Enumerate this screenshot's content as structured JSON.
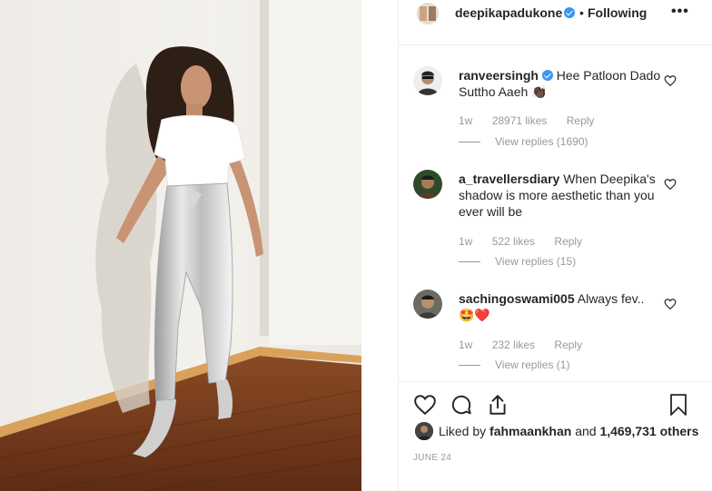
{
  "post": {
    "username": "deepikapadukone",
    "follow_status": "Following",
    "separator": "•",
    "more": "•••",
    "date": "JUNE 24"
  },
  "comments": [
    {
      "username": "ranveersingh",
      "verified": true,
      "text": "Hee Patloon Dado Suttho Aaeh 👏🏿",
      "age": "1w",
      "likes": "28971 likes",
      "reply": "Reply",
      "view_replies": "View replies (1690)"
    },
    {
      "username": "a_travellersdiary",
      "verified": false,
      "text": "When Deepika's shadow is more aesthetic than you ever will be",
      "age": "1w",
      "likes": "522 likes",
      "reply": "Reply",
      "view_replies": "View replies (15)"
    },
    {
      "username": "sachingoswami005",
      "verified": false,
      "text": "Always fev..",
      "text2": "🤩❤️",
      "age": "1w",
      "likes": "232 likes",
      "reply": "Reply",
      "view_replies": "View replies (1)"
    }
  ],
  "likes": {
    "prefix": "Liked by",
    "user": "fahmaankhan",
    "joiner": "and",
    "others": "1,469,731 others"
  },
  "icons": {
    "like": "heart-icon",
    "comment": "comment-icon",
    "share": "share-icon",
    "save": "bookmark-icon",
    "verified": "verified-badge-icon"
  },
  "colors": {
    "verified": "#3897f0",
    "text": "#262626",
    "muted": "#999999",
    "border": "#efefef"
  }
}
